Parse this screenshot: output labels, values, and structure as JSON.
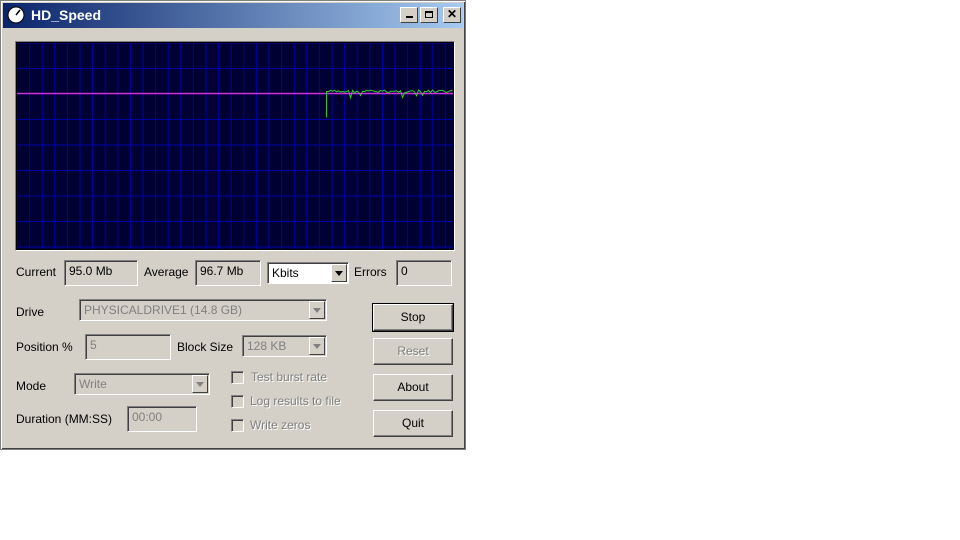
{
  "window": {
    "title": "HD_Speed"
  },
  "stats": {
    "current_label": "Current",
    "current_value": "95.0 Mb",
    "average_label": "Average",
    "average_value": "96.7 Mb",
    "unit_selected": "Kbits",
    "errors_label": "Errors",
    "errors_value": "0"
  },
  "settings": {
    "drive_label": "Drive",
    "drive_value": "PHYSICALDRIVE1 (14.8 GB)",
    "position_label": "Position %",
    "position_value": "5",
    "block_label": "Block Size",
    "block_value": "128 KB",
    "mode_label": "Mode",
    "mode_value": "Write",
    "duration_label": "Duration (MM:SS)",
    "duration_value": "00:00"
  },
  "options": {
    "burst_label": "Test burst rate",
    "log_label": "Log results to file",
    "zeros_label": "Write zeros"
  },
  "buttons": {
    "stop": "Stop",
    "reset": "Reset",
    "about": "About",
    "quit": "Quit"
  },
  "colors": {
    "graph_bg": "#000033",
    "grid": "#0000a8",
    "current_trace": "#33cc33",
    "average_line": "#cc33cc"
  },
  "graph": {
    "average_level": 0.755,
    "trace_start_fraction": 0.71,
    "trace_level": 0.755
  }
}
